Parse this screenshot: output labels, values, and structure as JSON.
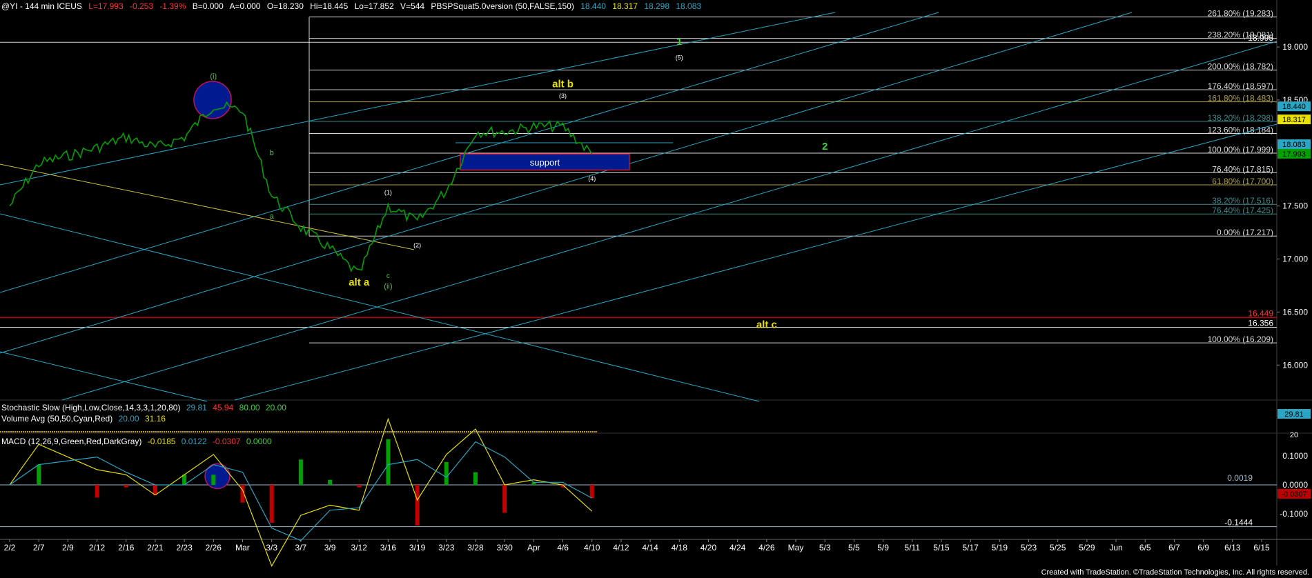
{
  "header": {
    "symbol": "@YI - 144 min  ICEUS",
    "last": "L=17.993",
    "change": "-0.253",
    "change_pct": "-1.39%",
    "bid": "B=0.000",
    "ask": "A=0.000",
    "open": "O=18.230",
    "high": "Hi=18.445",
    "low": "Lo=17.852",
    "volume": "V=544",
    "study": "PBSPSquat5.0version (50,FALSE,150)",
    "study_vals": [
      "18.440",
      "18.317",
      "18.298",
      "18.083"
    ]
  },
  "colors": {
    "background": "#000000",
    "price_bar": "#00a000",
    "channel": "#2aa6c4",
    "fib_line": "#d8d8d8",
    "fib_olive": "#b0a040",
    "fib_teal": "#3a8a8a",
    "red_line": "#c00000",
    "wave_yellow": "#e8e000",
    "wave_green": "#40d040",
    "support_box": "#001a90"
  },
  "chart_data": {
    "type": "line",
    "title": "",
    "ylim": [
      15.67,
      19.3
    ],
    "y_ticks": [
      "19.000",
      "18.500",
      "17.500",
      "17.000",
      "16.500",
      "16.000"
    ],
    "x_ticks": [
      "2/2",
      "2/7",
      "2/9",
      "2/12",
      "2/16",
      "2/21",
      "2/23",
      "2/26",
      "Mar",
      "3/3",
      "3/7",
      "3/9",
      "3/12",
      "3/16",
      "3/19",
      "3/23",
      "3/28",
      "3/30",
      "Apr",
      "4/6",
      "4/10",
      "4/12",
      "4/14",
      "4/18",
      "4/20",
      "4/24",
      "4/26",
      "May",
      "5/3",
      "5/5",
      "5/9",
      "5/11",
      "5/15",
      "5/17",
      "5/19",
      "5/23",
      "5/25",
      "5/29",
      "Jun",
      "6/5",
      "6/7",
      "6/9",
      "6/13",
      "6/15"
    ],
    "price_waypoints": [
      {
        "x": "2/2",
        "y": 17.5
      },
      {
        "x": "2/7",
        "y": 17.9
      },
      {
        "x": "2/12",
        "y": 18.05
      },
      {
        "x": "2/16",
        "y": 18.15
      },
      {
        "x": "2/21",
        "y": 18.05
      },
      {
        "x": "2/23",
        "y": 18.15
      },
      {
        "x": "2/26",
        "y": 18.45
      },
      {
        "x": "Mar",
        "y": 18.4
      },
      {
        "x": "3/3",
        "y": 17.6
      },
      {
        "x": "3/7",
        "y": 17.3
      },
      {
        "x": "3/9",
        "y": 17.1
      },
      {
        "x": "3/12",
        "y": 16.85
      },
      {
        "x": "3/16",
        "y": 17.5
      },
      {
        "x": "3/19",
        "y": 17.35
      },
      {
        "x": "3/23",
        "y": 17.65
      },
      {
        "x": "3/28",
        "y": 18.2
      },
      {
        "x": "3/30",
        "y": 18.2
      },
      {
        "x": "Apr",
        "y": 18.25
      },
      {
        "x": "4/6",
        "y": 18.25
      },
      {
        "x": "4/10",
        "y": 17.99
      }
    ],
    "fib_levels": [
      {
        "label": "261.80% (19.283)",
        "value": 19.283,
        "color": "#d8d8d8"
      },
      {
        "label": "238.20% (19.081)",
        "value": 19.081,
        "color": "#d8d8d8"
      },
      {
        "label": "200.00% (18.782)",
        "value": 18.782,
        "color": "#d8d8d8"
      },
      {
        "label": "176.40% (18.597)",
        "value": 18.597,
        "color": "#d8d8d8"
      },
      {
        "label": "161.80% (18.483)",
        "value": 18.483,
        "color": "#b0a040"
      },
      {
        "label": "138.20% (18.298)",
        "value": 18.298,
        "color": "#3a8a8a"
      },
      {
        "label": "123.60% (18.184)",
        "value": 18.184,
        "color": "#d8d8d8"
      },
      {
        "label": "100.00% (17.999)",
        "value": 17.999,
        "color": "#d8d8d8"
      },
      {
        "label": "76.40% (17.815)",
        "value": 17.815,
        "color": "#d8d8d8"
      },
      {
        "label": "61.80% (17.700)",
        "value": 17.7,
        "color": "#b0a040"
      },
      {
        "label": "38.20% (17.516)",
        "value": 17.516,
        "color": "#3a8a8a"
      },
      {
        "label": "76.40% (17.425)",
        "value": 17.425,
        "color": "#3a8a8a"
      },
      {
        "label": "0.00% (17.217)",
        "value": 17.217,
        "color": "#d8d8d8"
      },
      {
        "label": "100.00% (16.209)",
        "value": 16.209,
        "color": "#d8d8d8"
      }
    ],
    "extra_levels": [
      {
        "label": "18.995",
        "value": 19.045
      },
      {
        "label": "16.449",
        "value": 16.449
      },
      {
        "label": "16.356",
        "value": 16.356
      }
    ],
    "price_tags": [
      {
        "label": "18.440",
        "value": 18.44,
        "bg": "#2aa6c4",
        "fg": "#000000"
      },
      {
        "label": "18.317",
        "value": 18.317,
        "bg": "#e8e000",
        "fg": "#000000"
      },
      {
        "label": "18.083",
        "value": 18.083,
        "bg": "#2aa6c4",
        "fg": "#000000"
      },
      {
        "label": "17.993",
        "value": 17.993,
        "bg": "#00a000",
        "fg": "#000000"
      }
    ],
    "wave_labels": [
      {
        "text": "(i)",
        "x": "2/26",
        "y": 18.7,
        "color": "#40d040",
        "size": 11
      },
      {
        "text": "b",
        "x": "3/3",
        "y": 17.98,
        "color": "#40d040",
        "size": 11
      },
      {
        "text": "a",
        "x": "3/3",
        "y": 17.38,
        "color": "#40d040",
        "size": 11
      },
      {
        "text": "alt a",
        "x": "3/12",
        "y": 16.75,
        "color": "#e8e000",
        "size": 15,
        "bold": true
      },
      {
        "text": "c",
        "x": "3/16",
        "y": 16.82,
        "color": "#40d040",
        "size": 10
      },
      {
        "text": "(ii)",
        "x": "3/16",
        "y": 16.72,
        "color": "#40d040",
        "size": 11
      },
      {
        "text": "(1)",
        "x": "3/16",
        "y": 17.61,
        "color": "#ffffff",
        "size": 9
      },
      {
        "text": "(2)",
        "x": "3/19",
        "y": 17.11,
        "color": "#ffffff",
        "size": 9
      },
      {
        "text": "(3)",
        "x": "4/6",
        "y": 18.52,
        "color": "#ffffff",
        "size": 9
      },
      {
        "text": "(4)",
        "x": "4/10",
        "y": 17.74,
        "color": "#ffffff",
        "size": 9
      },
      {
        "text": "alt b",
        "x": "4/6",
        "y": 18.62,
        "color": "#e8e000",
        "size": 15,
        "bold": true
      },
      {
        "text": "(5)",
        "x": "4/18",
        "y": 18.88,
        "color": "#ffffff",
        "size": 9
      },
      {
        "text": "1",
        "x": "4/18",
        "y": 19.02,
        "color": "#40d040",
        "size": 15,
        "bold": true
      },
      {
        "text": "2",
        "x": "5/3",
        "y": 18.03,
        "color": "#40d040",
        "size": 15,
        "bold": true
      },
      {
        "text": "alt c",
        "x": "4/26",
        "y": 16.35,
        "color": "#e8e000",
        "size": 15,
        "bold": true
      }
    ],
    "support_label": "support"
  },
  "stochastic": {
    "label": "Stochastic Slow (High,Low,Close,14,3,3,1,20,80)",
    "vals": [
      "29.81",
      "45.94",
      "80.00",
      "20.00"
    ],
    "vol_label": "Volume Avg (50,50,Cyan,Red)",
    "vol_vals": [
      "20.00",
      "31.16"
    ],
    "axis_tags": [
      "29.81",
      "20"
    ]
  },
  "macd": {
    "label": "MACD (12,26,9,Green,Red,DarkGray)",
    "vals": [
      "-0.0185",
      "0.0122",
      "-0.0307",
      "0.0000"
    ],
    "y_ticks": [
      "0.1000",
      "0.0000",
      "-0.1000"
    ],
    "ann_top": "0.0019",
    "ann_bottom": "-0.1444",
    "last_tag": "-0.0307"
  },
  "footer": "Created with TradeStation. ©TradeStation Technologies, Inc. All rights reserved."
}
